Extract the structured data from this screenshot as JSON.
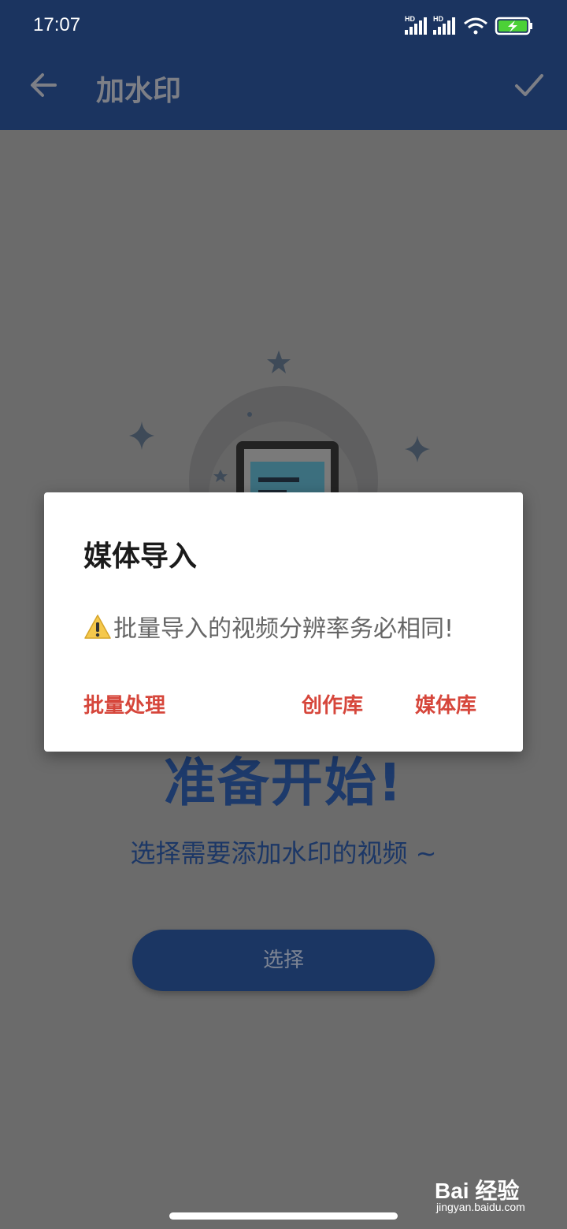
{
  "status_bar": {
    "time": "17:07",
    "signal_label": "HD"
  },
  "toolbar": {
    "title": "加水印",
    "back_icon": "arrow-left-icon",
    "confirm_icon": "check-icon"
  },
  "main": {
    "ready_title": "准备开始!",
    "subtitle": "选择需要添加水印的视频 ~",
    "select_button": "选择"
  },
  "dialog": {
    "title": "媒体导入",
    "message_icon": "warning-icon",
    "message": "批量导入的视频分辨率务必相同!",
    "buttons": {
      "batch": "批量处理",
      "creation": "创作库",
      "media": "媒体库"
    }
  },
  "watermark": {
    "logo": "Bai 经验",
    "url": "jingyan.baidu.com"
  },
  "colors": {
    "appbar": "#1b3460",
    "accent_button": "#d6463b",
    "primary": "#1d3a6b",
    "scrim": "#6b6b6b"
  }
}
